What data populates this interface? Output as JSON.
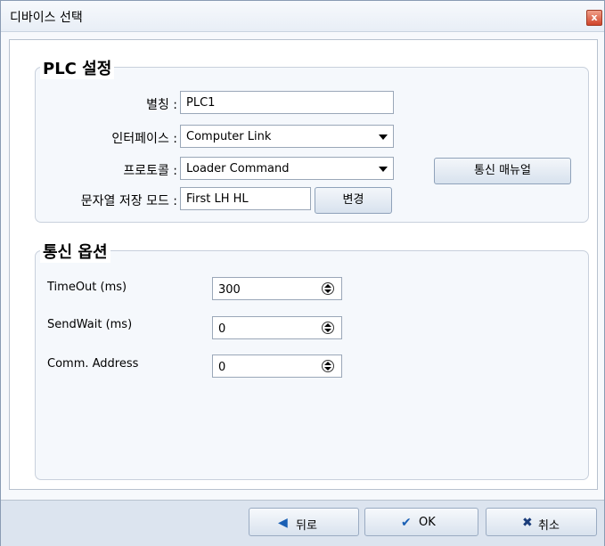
{
  "window": {
    "title": "디바이스 선택",
    "close_glyph": "x"
  },
  "plc_group": {
    "title": "PLC 설정",
    "alias_label": "별칭 :",
    "alias_value": "PLC1",
    "interface_label": "인터페이스 :",
    "interface_value": "Computer Link",
    "protocol_label": "프로토콜 :",
    "protocol_value": "Loader Command",
    "manual_button": "통신 매뉴얼",
    "string_mode_label": "문자열 저장 모드 :",
    "string_mode_value": "First LH HL",
    "change_button": "변경"
  },
  "comm_group": {
    "title": "통신 옵션",
    "timeout_label": "TimeOut (ms)",
    "timeout_value": "300",
    "sendwait_label": "SendWait (ms)",
    "sendwait_value": "0",
    "address_label": "Comm. Address",
    "address_value": "0"
  },
  "footer": {
    "back_label": "뒤로",
    "ok_label": "OK",
    "cancel_label": "취소"
  },
  "colors": {
    "back_icon": "#1a5fb4",
    "ok_icon": "#1a5fb4",
    "cancel_icon": "#1a3c7a"
  }
}
